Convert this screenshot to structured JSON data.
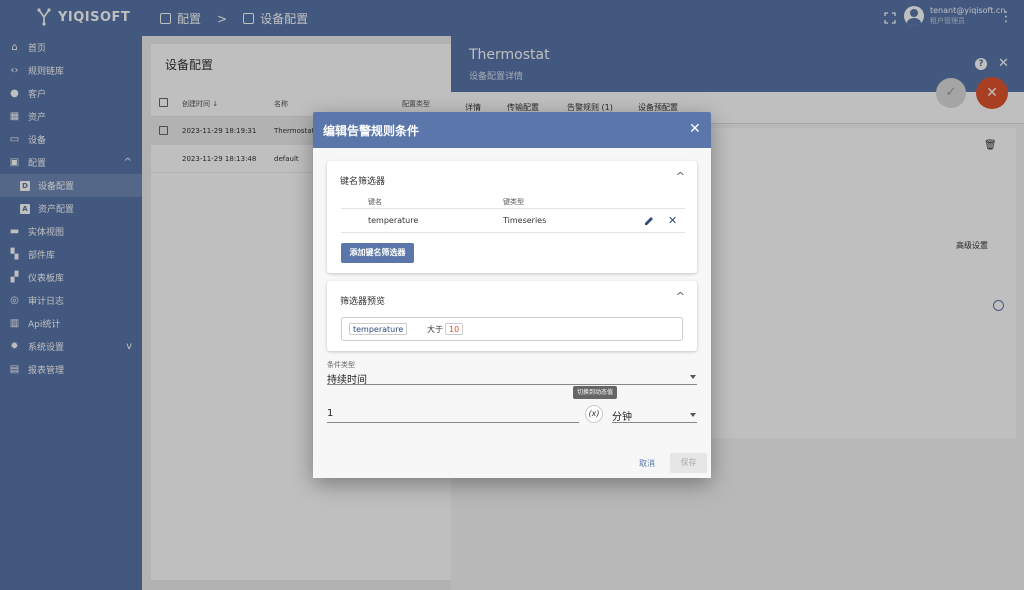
{
  "app": {
    "brand": "YIQISOFT",
    "user_email": "tenant@yiqisoft.cn",
    "user_role": "租户管理员"
  },
  "breadcrumb": {
    "parent": "配置",
    "current": "设备配置"
  },
  "sidebar": {
    "items": [
      {
        "label": "首页",
        "icon": "home-icon"
      },
      {
        "label": "规则链库",
        "icon": "code-icon"
      },
      {
        "label": "客户",
        "icon": "people-icon"
      },
      {
        "label": "资产",
        "icon": "building-icon"
      },
      {
        "label": "设备",
        "icon": "devices-icon"
      },
      {
        "label": "配置",
        "icon": "config-icon"
      },
      {
        "label": "设备配置",
        "icon": "device-profile-icon",
        "sub": true,
        "active": true
      },
      {
        "label": "资产配置",
        "icon": "asset-profile-icon",
        "sub": true
      },
      {
        "label": "实体视图",
        "icon": "entity-view-icon"
      },
      {
        "label": "部件库",
        "icon": "widgets-icon"
      },
      {
        "label": "仪表板库",
        "icon": "dashboard-icon"
      },
      {
        "label": "审计日志",
        "icon": "audit-icon"
      },
      {
        "label": "Api统计",
        "icon": "api-stats-icon"
      },
      {
        "label": "系统设置",
        "icon": "settings-icon"
      },
      {
        "label": "报表管理",
        "icon": "report-icon"
      }
    ]
  },
  "list": {
    "title": "设备配置",
    "col_created": "创建时间",
    "col_name": "名称",
    "col_type": "配置类型",
    "rows": [
      {
        "created": "2023-11-29 18:19:31",
        "name": "Thermostat"
      },
      {
        "created": "2023-11-29 18:13:48",
        "name": "default"
      }
    ]
  },
  "detail": {
    "title": "Thermostat",
    "subtitle": "设备配置详情",
    "tabs": [
      "详情",
      "传输配置",
      "告警规则 (1)",
      "设备预配置"
    ],
    "advanced": "高级设置"
  },
  "dialog": {
    "title": "编辑告警规则条件",
    "key_filter": {
      "title": "键名筛选器",
      "col_key": "键名",
      "col_type": "键类型",
      "row_key": "temperature",
      "row_type": "Timeseries",
      "add_button": "添加键名筛选器"
    },
    "preview": {
      "title": "筛选器预览",
      "key": "temperature",
      "op": "大于",
      "value": "10"
    },
    "condition_type": {
      "label": "条件类型",
      "value": "持续时间"
    },
    "duration": {
      "value": "1",
      "tooltip": "切换到动态值",
      "dynamic_symbol": "(x)",
      "unit": "分钟"
    },
    "cancel": "取消",
    "save": "保存"
  },
  "colors": {
    "primary": "#5a76aa",
    "accent": "#e0552f"
  }
}
